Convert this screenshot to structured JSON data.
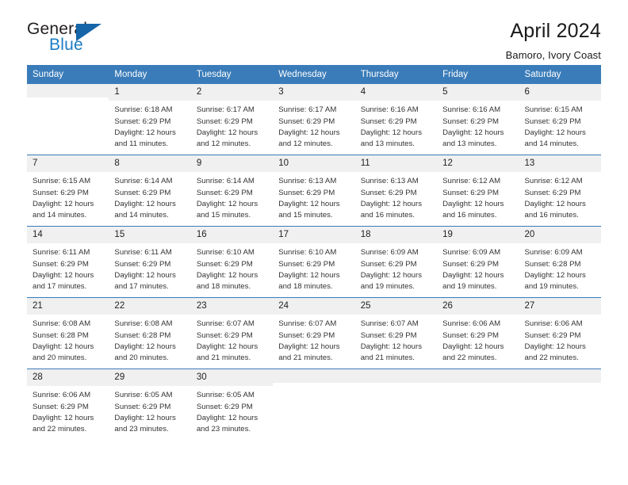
{
  "brand": {
    "word_general": "General",
    "word_blue": "Blue",
    "triangle_color": "#1565a8"
  },
  "header": {
    "title": "April 2024",
    "location": "Bamoro, Ivory Coast"
  },
  "theme": {
    "header_blue": "#3a7cb9",
    "daynum_gray": "#f0f0f0",
    "text": "#333333"
  },
  "weekdays": [
    "Sunday",
    "Monday",
    "Tuesday",
    "Wednesday",
    "Thursday",
    "Friday",
    "Saturday"
  ],
  "weeks": [
    [
      {
        "day": "",
        "sunrise": "",
        "sunset": "",
        "daylight1": "",
        "daylight2": "",
        "empty": true
      },
      {
        "day": "1",
        "sunrise": "Sunrise: 6:18 AM",
        "sunset": "Sunset: 6:29 PM",
        "daylight1": "Daylight: 12 hours",
        "daylight2": "and 11 minutes."
      },
      {
        "day": "2",
        "sunrise": "Sunrise: 6:17 AM",
        "sunset": "Sunset: 6:29 PM",
        "daylight1": "Daylight: 12 hours",
        "daylight2": "and 12 minutes."
      },
      {
        "day": "3",
        "sunrise": "Sunrise: 6:17 AM",
        "sunset": "Sunset: 6:29 PM",
        "daylight1": "Daylight: 12 hours",
        "daylight2": "and 12 minutes."
      },
      {
        "day": "4",
        "sunrise": "Sunrise: 6:16 AM",
        "sunset": "Sunset: 6:29 PM",
        "daylight1": "Daylight: 12 hours",
        "daylight2": "and 13 minutes."
      },
      {
        "day": "5",
        "sunrise": "Sunrise: 6:16 AM",
        "sunset": "Sunset: 6:29 PM",
        "daylight1": "Daylight: 12 hours",
        "daylight2": "and 13 minutes."
      },
      {
        "day": "6",
        "sunrise": "Sunrise: 6:15 AM",
        "sunset": "Sunset: 6:29 PM",
        "daylight1": "Daylight: 12 hours",
        "daylight2": "and 14 minutes."
      }
    ],
    [
      {
        "day": "7",
        "sunrise": "Sunrise: 6:15 AM",
        "sunset": "Sunset: 6:29 PM",
        "daylight1": "Daylight: 12 hours",
        "daylight2": "and 14 minutes."
      },
      {
        "day": "8",
        "sunrise": "Sunrise: 6:14 AM",
        "sunset": "Sunset: 6:29 PM",
        "daylight1": "Daylight: 12 hours",
        "daylight2": "and 14 minutes."
      },
      {
        "day": "9",
        "sunrise": "Sunrise: 6:14 AM",
        "sunset": "Sunset: 6:29 PM",
        "daylight1": "Daylight: 12 hours",
        "daylight2": "and 15 minutes."
      },
      {
        "day": "10",
        "sunrise": "Sunrise: 6:13 AM",
        "sunset": "Sunset: 6:29 PM",
        "daylight1": "Daylight: 12 hours",
        "daylight2": "and 15 minutes."
      },
      {
        "day": "11",
        "sunrise": "Sunrise: 6:13 AM",
        "sunset": "Sunset: 6:29 PM",
        "daylight1": "Daylight: 12 hours",
        "daylight2": "and 16 minutes."
      },
      {
        "day": "12",
        "sunrise": "Sunrise: 6:12 AM",
        "sunset": "Sunset: 6:29 PM",
        "daylight1": "Daylight: 12 hours",
        "daylight2": "and 16 minutes."
      },
      {
        "day": "13",
        "sunrise": "Sunrise: 6:12 AM",
        "sunset": "Sunset: 6:29 PM",
        "daylight1": "Daylight: 12 hours",
        "daylight2": "and 16 minutes."
      }
    ],
    [
      {
        "day": "14",
        "sunrise": "Sunrise: 6:11 AM",
        "sunset": "Sunset: 6:29 PM",
        "daylight1": "Daylight: 12 hours",
        "daylight2": "and 17 minutes."
      },
      {
        "day": "15",
        "sunrise": "Sunrise: 6:11 AM",
        "sunset": "Sunset: 6:29 PM",
        "daylight1": "Daylight: 12 hours",
        "daylight2": "and 17 minutes."
      },
      {
        "day": "16",
        "sunrise": "Sunrise: 6:10 AM",
        "sunset": "Sunset: 6:29 PM",
        "daylight1": "Daylight: 12 hours",
        "daylight2": "and 18 minutes."
      },
      {
        "day": "17",
        "sunrise": "Sunrise: 6:10 AM",
        "sunset": "Sunset: 6:29 PM",
        "daylight1": "Daylight: 12 hours",
        "daylight2": "and 18 minutes."
      },
      {
        "day": "18",
        "sunrise": "Sunrise: 6:09 AM",
        "sunset": "Sunset: 6:29 PM",
        "daylight1": "Daylight: 12 hours",
        "daylight2": "and 19 minutes."
      },
      {
        "day": "19",
        "sunrise": "Sunrise: 6:09 AM",
        "sunset": "Sunset: 6:29 PM",
        "daylight1": "Daylight: 12 hours",
        "daylight2": "and 19 minutes."
      },
      {
        "day": "20",
        "sunrise": "Sunrise: 6:09 AM",
        "sunset": "Sunset: 6:28 PM",
        "daylight1": "Daylight: 12 hours",
        "daylight2": "and 19 minutes."
      }
    ],
    [
      {
        "day": "21",
        "sunrise": "Sunrise: 6:08 AM",
        "sunset": "Sunset: 6:28 PM",
        "daylight1": "Daylight: 12 hours",
        "daylight2": "and 20 minutes."
      },
      {
        "day": "22",
        "sunrise": "Sunrise: 6:08 AM",
        "sunset": "Sunset: 6:28 PM",
        "daylight1": "Daylight: 12 hours",
        "daylight2": "and 20 minutes."
      },
      {
        "day": "23",
        "sunrise": "Sunrise: 6:07 AM",
        "sunset": "Sunset: 6:29 PM",
        "daylight1": "Daylight: 12 hours",
        "daylight2": "and 21 minutes."
      },
      {
        "day": "24",
        "sunrise": "Sunrise: 6:07 AM",
        "sunset": "Sunset: 6:29 PM",
        "daylight1": "Daylight: 12 hours",
        "daylight2": "and 21 minutes."
      },
      {
        "day": "25",
        "sunrise": "Sunrise: 6:07 AM",
        "sunset": "Sunset: 6:29 PM",
        "daylight1": "Daylight: 12 hours",
        "daylight2": "and 21 minutes."
      },
      {
        "day": "26",
        "sunrise": "Sunrise: 6:06 AM",
        "sunset": "Sunset: 6:29 PM",
        "daylight1": "Daylight: 12 hours",
        "daylight2": "and 22 minutes."
      },
      {
        "day": "27",
        "sunrise": "Sunrise: 6:06 AM",
        "sunset": "Sunset: 6:29 PM",
        "daylight1": "Daylight: 12 hours",
        "daylight2": "and 22 minutes."
      }
    ],
    [
      {
        "day": "28",
        "sunrise": "Sunrise: 6:06 AM",
        "sunset": "Sunset: 6:29 PM",
        "daylight1": "Daylight: 12 hours",
        "daylight2": "and 22 minutes."
      },
      {
        "day": "29",
        "sunrise": "Sunrise: 6:05 AM",
        "sunset": "Sunset: 6:29 PM",
        "daylight1": "Daylight: 12 hours",
        "daylight2": "and 23 minutes."
      },
      {
        "day": "30",
        "sunrise": "Sunrise: 6:05 AM",
        "sunset": "Sunset: 6:29 PM",
        "daylight1": "Daylight: 12 hours",
        "daylight2": "and 23 minutes."
      },
      {
        "day": "",
        "sunrise": "",
        "sunset": "",
        "daylight1": "",
        "daylight2": "",
        "empty": true
      },
      {
        "day": "",
        "sunrise": "",
        "sunset": "",
        "daylight1": "",
        "daylight2": "",
        "empty": true
      },
      {
        "day": "",
        "sunrise": "",
        "sunset": "",
        "daylight1": "",
        "daylight2": "",
        "empty": true
      },
      {
        "day": "",
        "sunrise": "",
        "sunset": "",
        "daylight1": "",
        "daylight2": "",
        "empty": true
      }
    ]
  ]
}
